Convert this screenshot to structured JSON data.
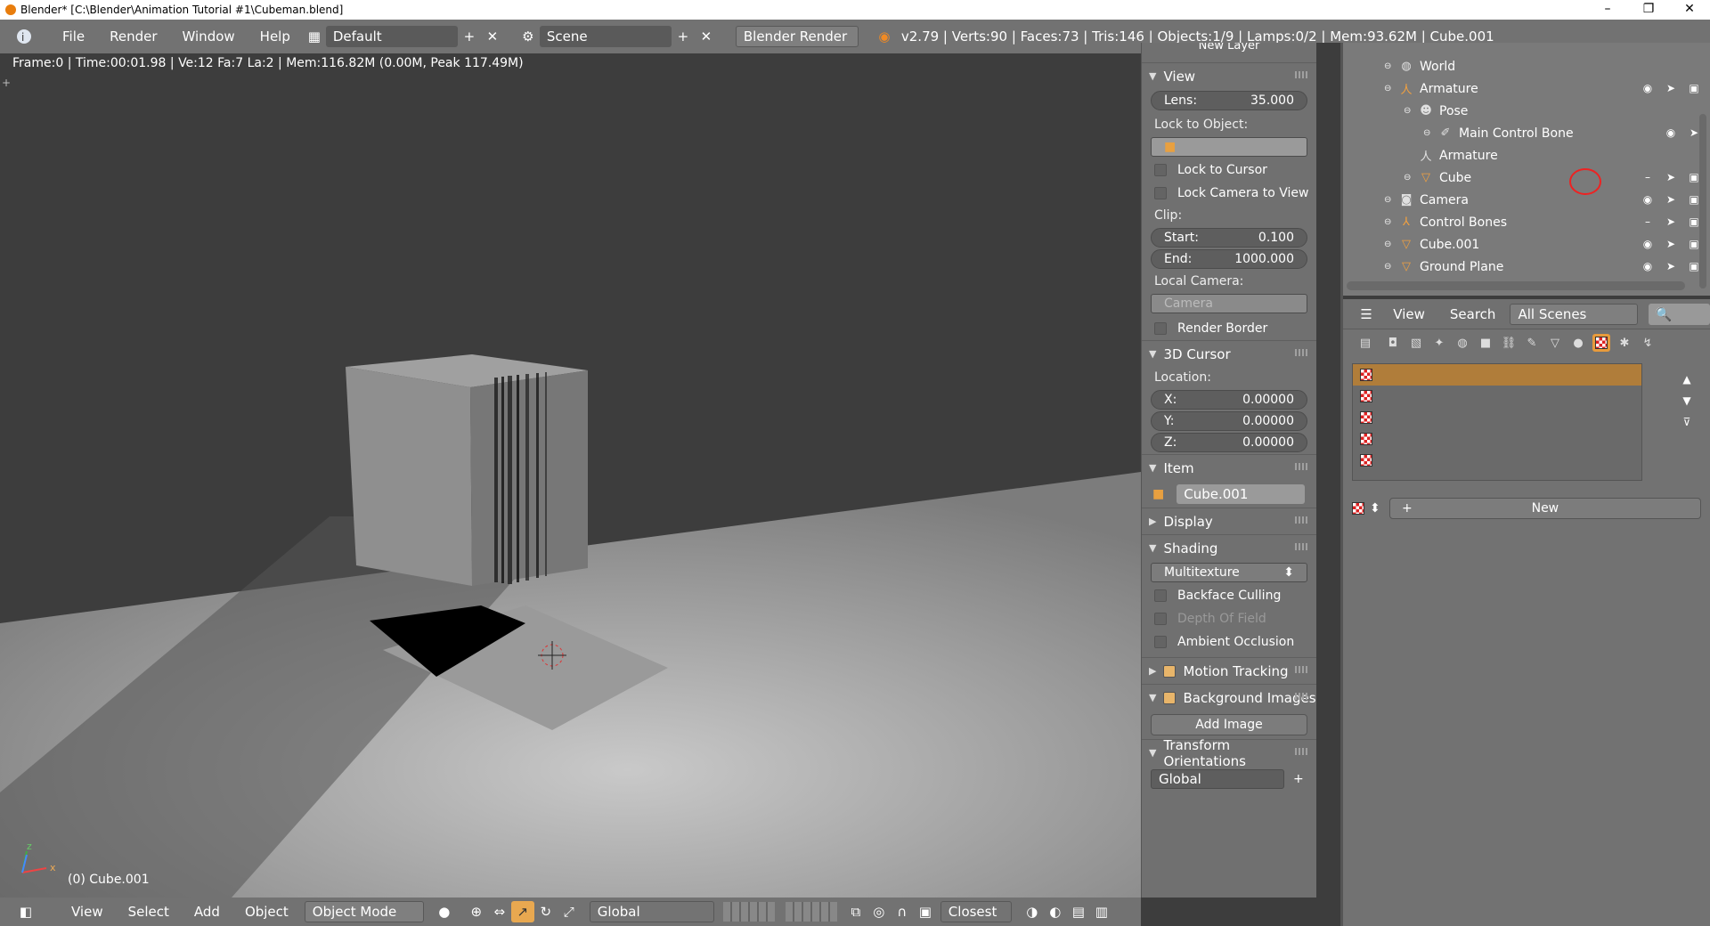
{
  "window": {
    "title": "Blender* [C:\\Blender\\Animation Tutorial #1\\Cubeman.blend]",
    "controls": [
      "–",
      "❐",
      "✕"
    ]
  },
  "topbar": {
    "menus": [
      "File",
      "Render",
      "Window",
      "Help"
    ],
    "layout": "Default",
    "scene": "Scene",
    "engine": "Blender Render",
    "stats": "v2.79 | Verts:90 | Faces:73 | Tris:146 | Objects:1/9 | Lamps:0/2 | Mem:93.62M | Cube.001"
  },
  "viewport": {
    "info": "Frame:0 | Time:00:01.98 | Ve:12 Fa:7 La:2 | Mem:116.82M (0.00M, Peak 117.49M)",
    "object_label": "(0) Cube.001",
    "axes": {
      "x": "x",
      "y": "y",
      "z": "z"
    }
  },
  "viewport_header": {
    "menus": [
      "View",
      "Select",
      "Add",
      "Object"
    ],
    "mode": "Object Mode",
    "orientation": "Global",
    "snap": "Closest"
  },
  "npanel": {
    "new_layer": "New Layer",
    "view": {
      "header": "View",
      "lens_label": "Lens:",
      "lens_value": "35.000",
      "lock_to_object": "Lock to Object:",
      "lock_to_cursor": "Lock to Cursor",
      "lock_camera": "Lock Camera to View",
      "clip": "Clip:",
      "start_label": "Start:",
      "start_value": "0.100",
      "end_label": "End:",
      "end_value": "1000.000",
      "local_camera": "Local Camera:",
      "camera_value": "Camera",
      "render_border": "Render Border"
    },
    "cursor": {
      "header": "3D Cursor",
      "location": "Location:",
      "x_label": "X:",
      "x_value": "0.00000",
      "y_label": "Y:",
      "y_value": "0.00000",
      "z_label": "Z:",
      "z_value": "0.00000"
    },
    "item": {
      "header": "Item",
      "name": "Cube.001"
    },
    "display": {
      "header": "Display"
    },
    "shading": {
      "header": "Shading",
      "mode": "Multitexture",
      "backface": "Backface Culling",
      "dof": "Depth Of Field",
      "ao": "Ambient Occlusion"
    },
    "motion_tracking": "Motion Tracking",
    "background_images": "Background Images",
    "add_image": "Add Image",
    "transform_orientations": "Transform Orientations",
    "orientation_value": "Global"
  },
  "outliner": {
    "rows": [
      {
        "label": "World",
        "indent": 1,
        "icon": "world-icon"
      },
      {
        "label": "Armature",
        "indent": 1,
        "icon": "armature-icon"
      },
      {
        "label": "Pose",
        "indent": 2,
        "icon": "pose-icon"
      },
      {
        "label": "Main Control Bone",
        "indent": 3,
        "icon": "bone-icon"
      },
      {
        "label": "Armature",
        "indent": 2,
        "icon": "armature-data-icon"
      },
      {
        "label": "Cube",
        "indent": 2,
        "icon": "mesh-icon"
      },
      {
        "label": "Camera",
        "indent": 1,
        "icon": "camera-icon"
      },
      {
        "label": "Control Bones",
        "indent": 1,
        "icon": "empty-icon"
      },
      {
        "label": "Cube.001",
        "indent": 1,
        "icon": "mesh-icon"
      },
      {
        "label": "Ground Plane",
        "indent": 1,
        "icon": "mesh-icon"
      }
    ]
  },
  "props": {
    "menus": [
      "View",
      "Search"
    ],
    "scenes": "All Scenes",
    "new_button": "New"
  }
}
